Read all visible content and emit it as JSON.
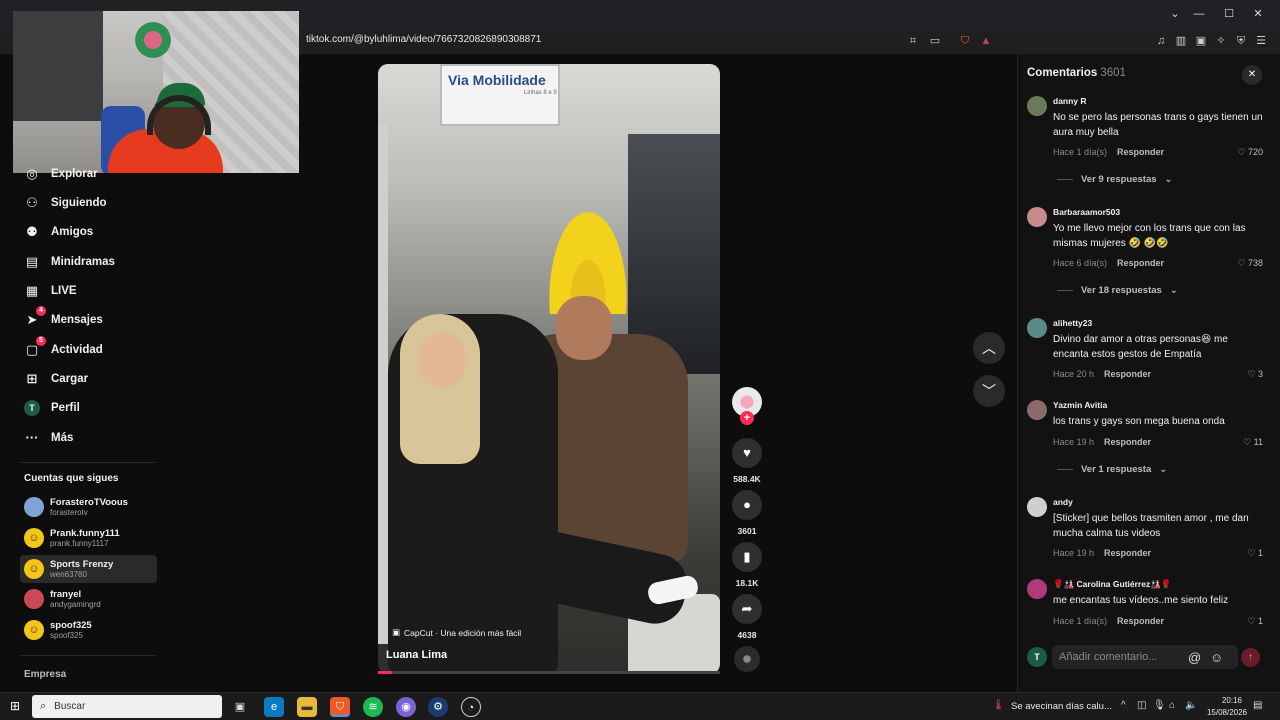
{
  "browser": {
    "url": "tiktok.com/@byluhlima/video/7667320826890308871",
    "toolbar_icons": [
      "translate-icon",
      "cast-icon",
      "brave-shield-icon",
      "rewards-icon",
      "media-icon",
      "sidebar-icon",
      "wallet-icon",
      "leo-icon",
      "vpn-icon",
      "menu-icon"
    ]
  },
  "sidebar": {
    "items": [
      {
        "label": "Explorar",
        "icon": "explore-icon"
      },
      {
        "label": "Siguiendo",
        "icon": "following-icon"
      },
      {
        "label": "Amigos",
        "icon": "friends-icon"
      },
      {
        "label": "Minidramas",
        "icon": "minidramas-icon"
      },
      {
        "label": "LIVE",
        "icon": "live-icon"
      },
      {
        "label": "Mensajes",
        "icon": "messages-icon",
        "badge": "4"
      },
      {
        "label": "Actividad",
        "icon": "activity-icon",
        "badge": "5"
      },
      {
        "label": "Cargar",
        "icon": "upload-icon"
      },
      {
        "label": "Perfil",
        "icon": "profile-icon",
        "avatar_letter": "T"
      },
      {
        "label": "Más",
        "icon": "more-icon"
      }
    ],
    "following_title": "Cuentas que sigues",
    "accounts": [
      {
        "name": "ForasteroTVoous",
        "user": "forasterotv"
      },
      {
        "name": "Prank.funny111",
        "user": "prank.funny1117"
      },
      {
        "name": "Sports Frenzy",
        "user": "wen63780"
      },
      {
        "name": "franyel",
        "user": "andygamingrd"
      },
      {
        "name": "spoof325",
        "user": "spoof325"
      }
    ],
    "footer": "Empresa"
  },
  "video": {
    "sign_text": "Via Mobilidade",
    "sign_sub": "Linhas 8 e 9",
    "capcut": "CapCut · Una edición más fácil",
    "author": "Luana Lima",
    "progress": 0.04
  },
  "actions": {
    "likes": "588.4K",
    "comments": "3601",
    "saves": "18.1K",
    "shares": "4638"
  },
  "comments_panel": {
    "title": "Comentarios",
    "count": "3601",
    "items": [
      {
        "user": "danny R",
        "text": "No se pero las personas trans o gays tienen un aura muy bella",
        "time": "Hace 1 día(s)",
        "reply": "Responder",
        "likes": "720",
        "view_replies": "Ver 9 respuestas"
      },
      {
        "user": "Barbaraamor503",
        "text": "Yo me llevo mejor con los trans que con las mismas mujeres 🤣 🤣🤣",
        "time": "Hace 6 día(s)",
        "reply": "Responder",
        "likes": "738",
        "view_replies": "Ver 18 respuestas"
      },
      {
        "user": "alihetty23",
        "text": "Divino dar amor a otras personas😆 me encanta estos gestos de Empatía",
        "time": "Hace 20 h",
        "reply": "Responder",
        "likes": "3"
      },
      {
        "user": "Yazmin Avitia",
        "text": "los trans y gays son mega buena onda",
        "time": "Hace 19 h",
        "reply": "Responder",
        "likes": "11",
        "view_replies": "Ver 1 respuesta"
      },
      {
        "user": "andy",
        "text": "[Sticker] que bellos trasmiten amor , me dan mucha calma tus videos",
        "time": "Hace 19 h",
        "reply": "Responder",
        "likes": "1"
      },
      {
        "user": "🌹🎎 Carolina Gutiérrez🎎🌹",
        "text": "me encantas tus vídeos..me siento feliz",
        "time": "Hace 1 día(s)",
        "reply": "Responder",
        "likes": "1"
      }
    ],
    "input_placeholder": "Añadir comentario...",
    "self_avatar": "T"
  },
  "taskbar": {
    "search_label": "Buscar",
    "weather": "Se avecinan días calu...",
    "time": "20:16",
    "date": "15/08/2026"
  }
}
